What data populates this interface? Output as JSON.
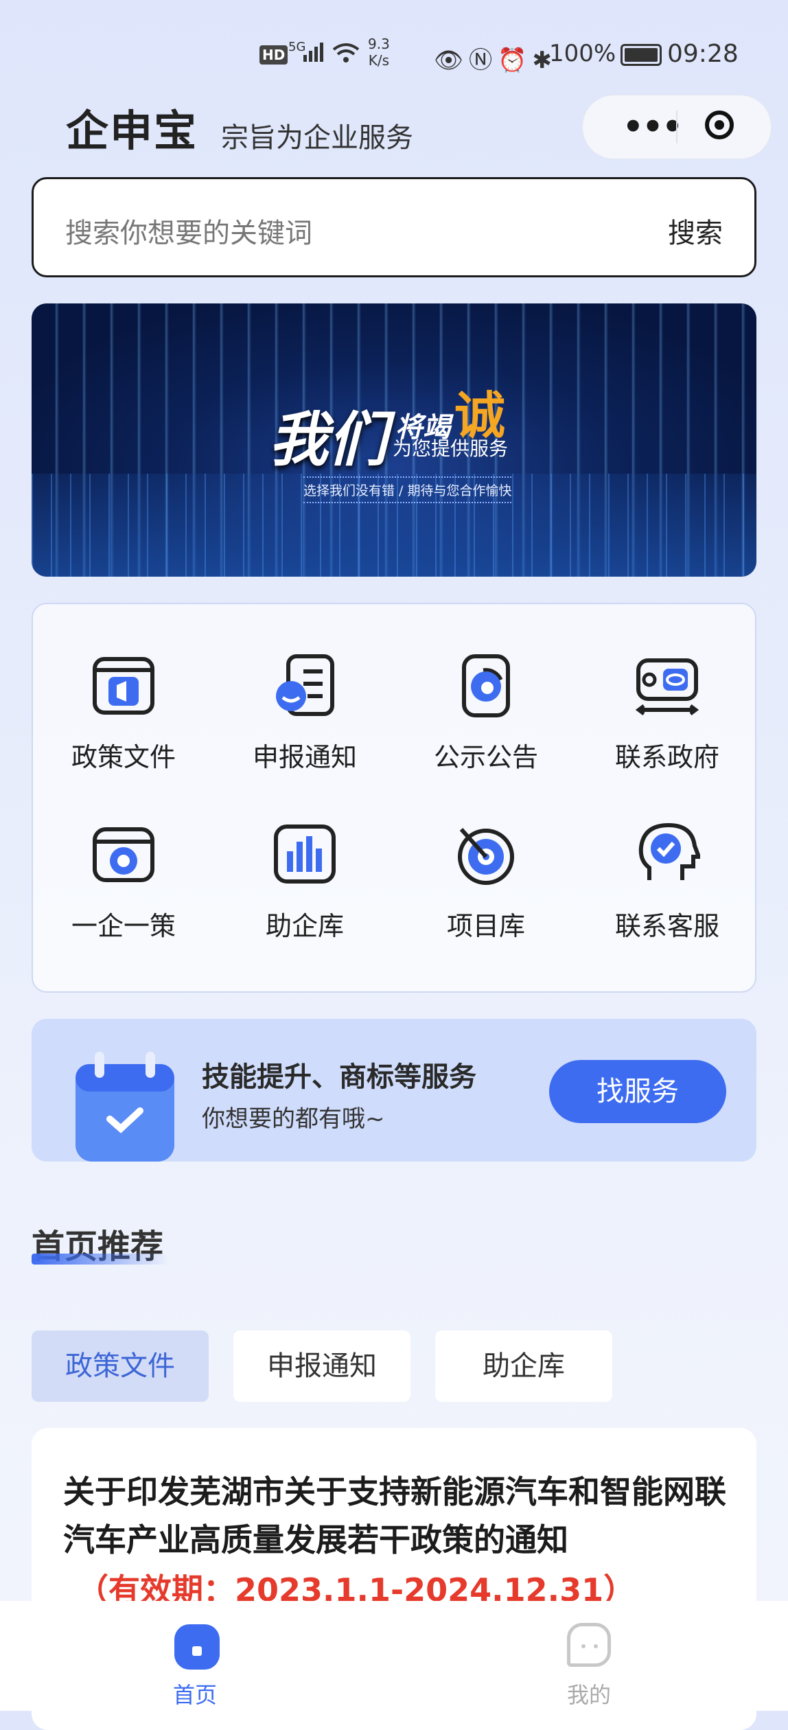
{
  "status_bar": {
    "hd": "HD",
    "network": "5G",
    "speed_value": "9.3",
    "speed_unit": "K/s",
    "battery": "100%",
    "time": "09:28"
  },
  "header": {
    "brand": "企申宝",
    "slogan": "宗旨为企业服务",
    "capsule_more": "•••"
  },
  "search": {
    "placeholder": "搜索你想要的关键词",
    "button": "搜索"
  },
  "banner": {
    "headline": "我们",
    "headline_mid": "将竭",
    "headline_accent": "诚",
    "sub": "为您提供服务",
    "tagline": "选择我们没有错 / 期待与您合作愉快"
  },
  "menu": {
    "items": [
      {
        "label": "政策文件",
        "icon": "policy-file-icon"
      },
      {
        "label": "申报通知",
        "icon": "declaration-notice-icon"
      },
      {
        "label": "公示公告",
        "icon": "announcement-icon"
      },
      {
        "label": "联系政府",
        "icon": "contact-government-icon"
      },
      {
        "label": "一企一策",
        "icon": "one-policy-icon"
      },
      {
        "label": "助企库",
        "icon": "enterprise-library-icon"
      },
      {
        "label": "项目库",
        "icon": "project-library-icon"
      },
      {
        "label": "联系客服",
        "icon": "customer-service-icon"
      }
    ]
  },
  "promo": {
    "title": "技能提升、商标等服务",
    "subtitle": "你想要的都有哦~",
    "button": "找服务"
  },
  "recommend": {
    "title": "首页推荐",
    "tabs": [
      "政策文件",
      "申报通知",
      "助企库"
    ],
    "active_tab": "政策文件",
    "card": {
      "title": "关于印发芜湖市关于支持新能源汽车和智能网联汽车产业高质量发展若干政策的通知",
      "validity": "（有效期：2023.1.1-2024.12.31）"
    }
  },
  "tabbar": {
    "home": "首页",
    "mine": "我的"
  },
  "colors": {
    "accent": "#3d6cf0",
    "validity_red": "#e53a2c"
  }
}
